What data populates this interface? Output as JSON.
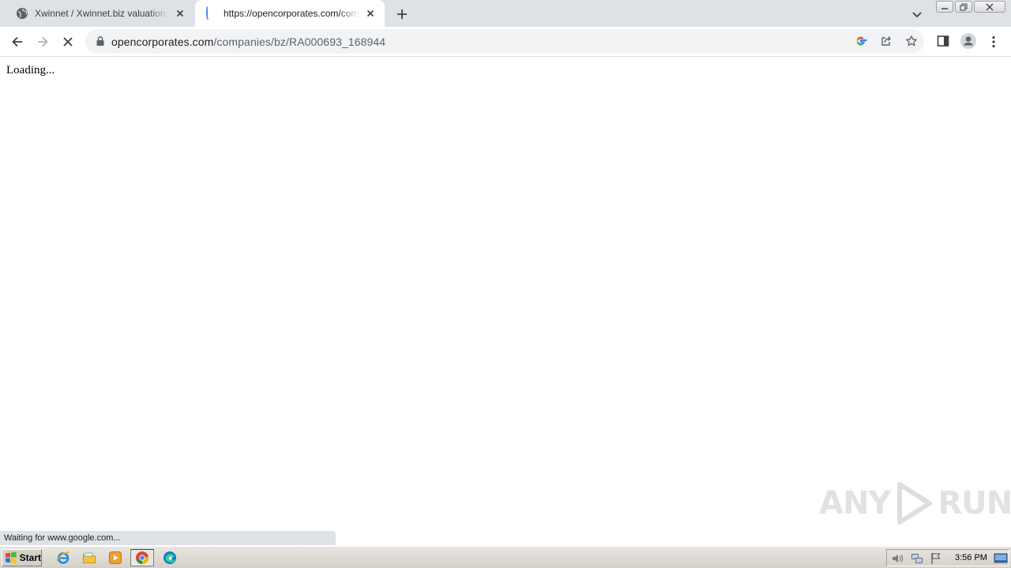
{
  "tabs": [
    {
      "title": "Xwinnet / Xwinnet.biz valuation and",
      "active": false,
      "favicon": "globe-icon"
    },
    {
      "title": "https://opencorporates.com/companies",
      "active": true,
      "favicon": "loading-spinner"
    }
  ],
  "omnibox": {
    "domain": "opencorporates.com",
    "path": "/companies/bz/RA000693_168944"
  },
  "page": {
    "loading_text": "Loading..."
  },
  "status_bar": {
    "text": "Waiting for www.google.com..."
  },
  "watermark": {
    "left": "ANY",
    "right": "RUN"
  },
  "taskbar": {
    "start_label": "Start",
    "clock": "3:56 PM",
    "quick_launch": [
      "ie-icon",
      "explorer-icon",
      "media-player-icon",
      "chrome-icon",
      "edge-icon"
    ]
  },
  "colors": {
    "tabstrip_bg": "#dee1e6",
    "omnibox_bg": "#f1f3f4",
    "taskbar_bg": "#d4d0c8",
    "spinner": "#4285f4"
  }
}
